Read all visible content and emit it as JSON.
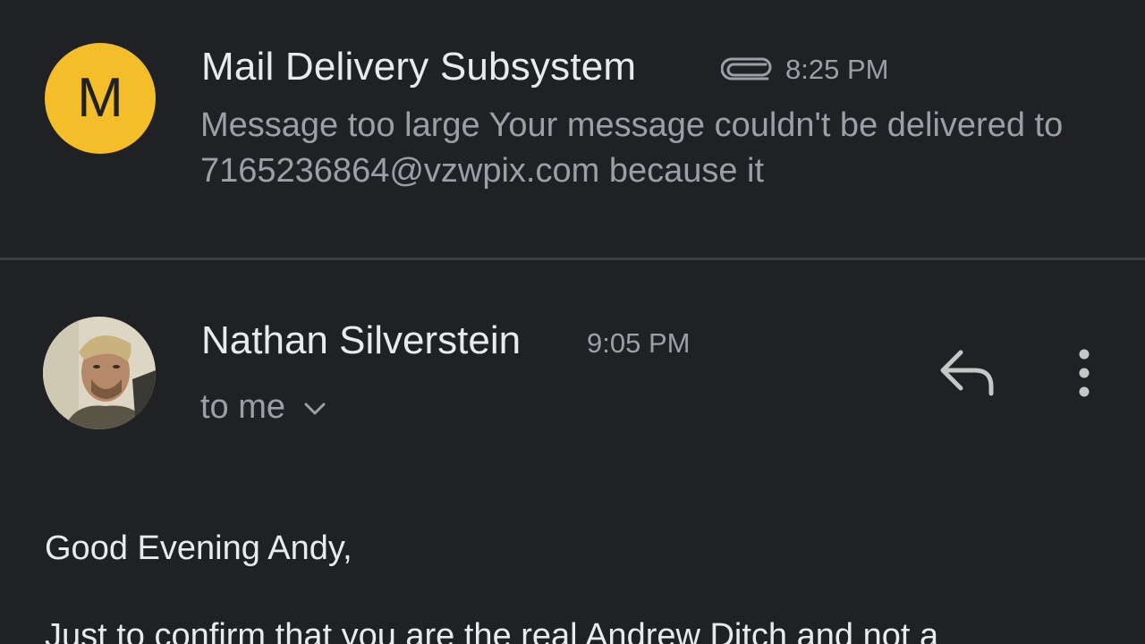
{
  "messages": [
    {
      "avatar_letter": "M",
      "avatar_color": "#f4bd2a",
      "sender": "Mail Delivery Subsystem",
      "attachment_icon": "paperclip-icon",
      "time": "8:25 PM",
      "snippet": "Message too large Your message couldn't be delivered to 7165236864@vzwpix.com because it"
    },
    {
      "avatar_type": "photo",
      "sender": "Nathan Silverstein",
      "time": "9:05 PM",
      "recipients_label": "to me",
      "recipients_icon": "chevron-down-icon",
      "reply_icon": "reply-icon",
      "more_icon": "more-vert-icon",
      "body": {
        "greeting": "Good Evening Andy,",
        "line1": "Just to confirm that you are the real Andrew Ditch and not a"
      }
    }
  ],
  "colors": {
    "background": "#202124",
    "primary_text": "#e8eaed",
    "secondary_text": "#9aa0a6",
    "divider": "#3c4043"
  }
}
